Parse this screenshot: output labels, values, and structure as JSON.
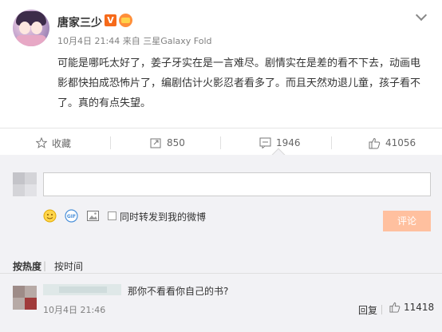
{
  "post": {
    "username": "唐家三少",
    "verified_badge": "V",
    "meta_time": "10月4日 21:44",
    "meta_source_prefix": "来自",
    "meta_source": "三星Galaxy Fold",
    "content": "可能是哪吒太好了，姜子牙实在是一言难尽。剧情实在是差的看不下去，动画电影都快拍成恐怖片了，编剧估计火影忍者看多了。而且天然劝退儿童，孩子看不了。真的有点失望。",
    "icons": {
      "verified": "verified-v-icon",
      "member": "crown-badge-icon",
      "menu": "chevron-down-icon"
    }
  },
  "actions": {
    "favorite_label": "收藏",
    "repost_count": "850",
    "comment_count": "1946",
    "like_count": "41056"
  },
  "comment_box": {
    "input_value": "",
    "forward_label": "同时转发到我的微博",
    "submit_label": "评论",
    "colors": {
      "submit_bg": "#ffc09f"
    }
  },
  "sort": {
    "hot_label": "按热度",
    "separator": "|",
    "time_label": "按时间"
  },
  "comments": [
    {
      "text": "那你不看看你自己的书?",
      "time": "10月4日 21:46",
      "reply_label": "回复",
      "like_count": "11418"
    }
  ]
}
